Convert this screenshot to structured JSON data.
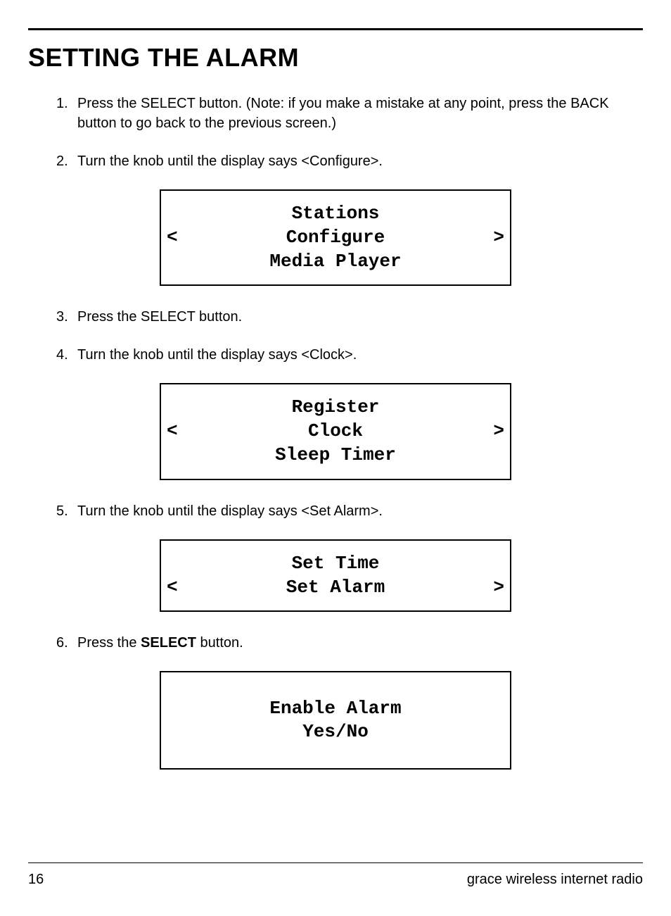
{
  "heading": "SETTING THE ALARM",
  "steps": {
    "s1": {
      "num": "1.",
      "text": "Press the SELECT button. (Note: if you make a mistake at any point, press the BACK button to go back to the previous screen.)"
    },
    "s2": {
      "num": "2.",
      "text": "Turn the knob until the display says <Configure>."
    },
    "s3": {
      "num": "3.",
      "text": "Press the SELECT button."
    },
    "s4": {
      "num": "4.",
      "text": "Turn the knob until the display says <Clock>."
    },
    "s5": {
      "num": "5.",
      "text": "Turn the knob until the display says <Set Alarm>."
    },
    "s6": {
      "num": "6.",
      "prefix": "Press the ",
      "bold": "SELECT",
      "suffix": " button."
    }
  },
  "displays": {
    "d1": {
      "line1": "Stations",
      "selected": "Configure",
      "line3": "Media Player",
      "left": "<",
      "right": ">"
    },
    "d2": {
      "line1": "Register",
      "selected": "Clock",
      "line3": "Sleep Timer",
      "left": "<",
      "right": ">"
    },
    "d3": {
      "line1": "Set Time",
      "selected": "Set Alarm",
      "line3": "",
      "left": "<",
      "right": ">"
    },
    "d4": {
      "line1": "Enable Alarm",
      "line2": "Yes/No"
    }
  },
  "footer": {
    "page": "16",
    "product": "grace wireless internet radio"
  }
}
